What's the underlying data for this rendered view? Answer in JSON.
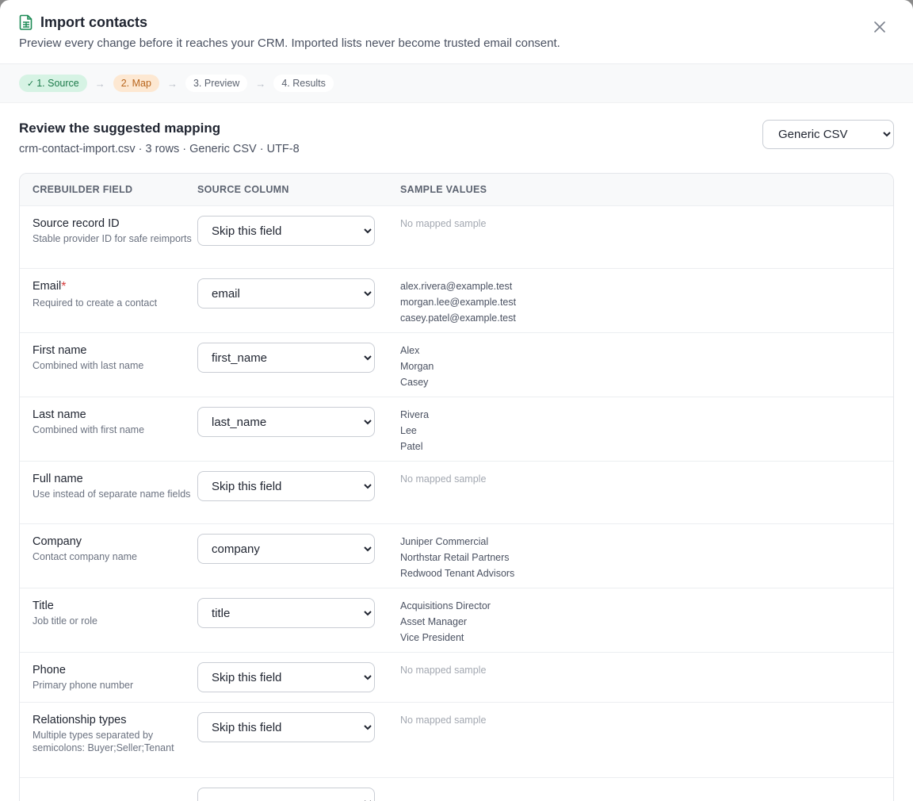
{
  "header": {
    "title": "Import contacts",
    "subtitle": "Preview every change before it reaches your CRM. Imported lists never become trusted email consent."
  },
  "steps": [
    {
      "label": "1. Source",
      "state": "done"
    },
    {
      "label": "2. Map",
      "state": "active"
    },
    {
      "label": "3. Preview",
      "state": "todo"
    },
    {
      "label": "4. Results",
      "state": "todo"
    }
  ],
  "section": {
    "title": "Review the suggested mapping",
    "meta": "crm-contact-import.csv · 3 rows · Generic CSV · UTF-8",
    "preset": "Generic CSV"
  },
  "table": {
    "headers": [
      "CREBUILDER FIELD",
      "SOURCE COLUMN",
      "SAMPLE VALUES"
    ],
    "empty_sample": "No mapped sample",
    "rows": [
      {
        "name": "Source record ID",
        "required": false,
        "desc": "Stable provider ID for safe reimports",
        "source": "Skip this field",
        "samples": []
      },
      {
        "name": "Email",
        "required": true,
        "desc": "Required to create a contact",
        "source": "email",
        "samples": [
          "alex.rivera@example.test",
          "morgan.lee@example.test",
          "casey.patel@example.test"
        ]
      },
      {
        "name": "First name",
        "required": false,
        "desc": "Combined with last name",
        "source": "first_name",
        "samples": [
          "Alex",
          "Morgan",
          "Casey"
        ]
      },
      {
        "name": "Last name",
        "required": false,
        "desc": "Combined with first name",
        "source": "last_name",
        "samples": [
          "Rivera",
          "Lee",
          "Patel"
        ]
      },
      {
        "name": "Full name",
        "required": false,
        "desc": "Use instead of separate name fields",
        "source": "Skip this field",
        "samples": []
      },
      {
        "name": "Company",
        "required": false,
        "desc": "Contact company name",
        "source": "company",
        "samples": [
          "Juniper Commercial",
          "Northstar Retail Partners",
          "Redwood Tenant Advisors"
        ]
      },
      {
        "name": "Title",
        "required": false,
        "desc": "Job title or role",
        "source": "title",
        "samples": [
          "Acquisitions Director",
          "Asset Manager",
          "Vice President"
        ]
      },
      {
        "name": "Phone",
        "required": false,
        "desc": "Primary phone number",
        "source": "Skip this field",
        "samples": []
      },
      {
        "name": "Relationship types",
        "required": false,
        "desc": "Multiple types separated by semicolons: Buyer;Seller;Tenant",
        "source": "Skip this field",
        "samples": []
      }
    ]
  },
  "icons": {
    "header": "spreadsheet-icon",
    "close": "close-icon",
    "done": "check-icon",
    "arrow": "arrow-right-icon"
  },
  "colors": {
    "accent_green": "#1c7a4a",
    "accent_orange": "#b8651c",
    "required": "#d63b3b"
  }
}
